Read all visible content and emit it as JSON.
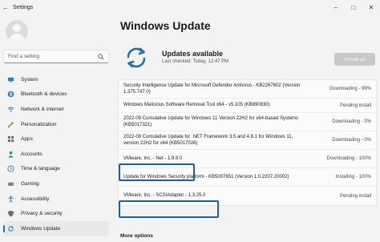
{
  "window": {
    "title": "Settings"
  },
  "sidebar": {
    "search_placeholder": "Find a setting",
    "items": [
      {
        "label": "System",
        "icon": "monitor-icon",
        "color": "#2f79c6"
      },
      {
        "label": "Bluetooth & devices",
        "icon": "bluetooth-icon",
        "color": "#2f79c6"
      },
      {
        "label": "Network & internet",
        "icon": "wifi-icon",
        "color": "#3a6fb8"
      },
      {
        "label": "Personalization",
        "icon": "brush-icon",
        "color": "#d07a2c"
      },
      {
        "label": "Apps",
        "icon": "apps-icon",
        "color": "#6b6b6b"
      },
      {
        "label": "Accounts",
        "icon": "person-icon",
        "color": "#1f9a5a"
      },
      {
        "label": "Time & language",
        "icon": "globe-clock-icon",
        "color": "#2f79c6"
      },
      {
        "label": "Gaming",
        "icon": "gamepad-icon",
        "color": "#6b6b6b"
      },
      {
        "label": "Accessibility",
        "icon": "accessibility-icon",
        "color": "#2f79c6"
      },
      {
        "label": "Privacy & security",
        "icon": "shield-icon",
        "color": "#6b6b6b"
      },
      {
        "label": "Windows Update",
        "icon": "windows-update-icon",
        "color": "#2f79c6",
        "active": true
      }
    ]
  },
  "main": {
    "title": "Windows Update",
    "status": {
      "title": "Updates available",
      "subtitle": "Last checked: Today, 12:47 PM",
      "button": "Install all"
    },
    "updates": [
      {
        "name": "Security Intelligence Update for Microsoft Defender Antivirus - KB2267602 (Version 1.375.747.0)",
        "status": "Downloading - 99%"
      },
      {
        "name": "Windows Malicious Software Removal Tool x64 - v5.105 (KB890830)",
        "status": "Pending install"
      },
      {
        "name": "2022-09 Cumulative Update for Windows 11 Version 22H2 for x64-based Systems (KB5017321)",
        "status": "Downloading - 0%"
      },
      {
        "name": "2022-09 Cumulative Update for .NET Framework 3.5 and 4.8.1 for Windows 11, version 22H2 for x64 (KB5017026)",
        "status": "Downloading - 0%"
      },
      {
        "name": "VMware, Inc. - Net - 1.9.9.0",
        "status": "Downloading - 100%"
      },
      {
        "name": "Update for Windows Security platform - KB5007651 (Version 1.0.2207.20002)",
        "status": "Installing - 100%"
      },
      {
        "name": "VMware, Inc. - SCSIAdapter - 1.3.25.0",
        "status": "Pending install"
      }
    ],
    "more_options": "More options"
  },
  "colors": {
    "accent": "#1f6fb5",
    "highlight": "#1d5fa0"
  }
}
